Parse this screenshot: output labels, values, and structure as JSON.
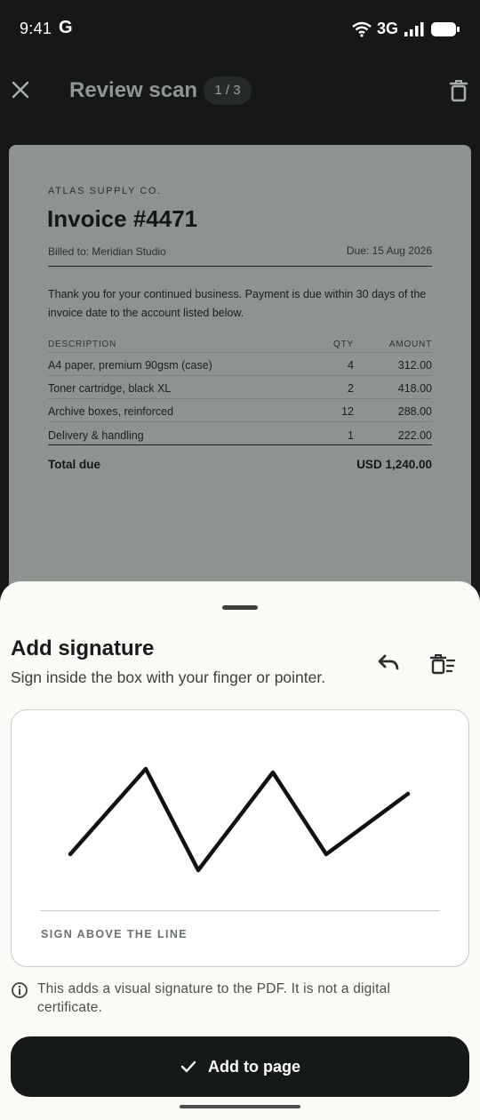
{
  "status": {
    "time": "9:41",
    "google": "G",
    "network": "3G"
  },
  "app_bar": {
    "title": "Review scan",
    "page_indicator": "1 / 3"
  },
  "document": {
    "company": "ATLAS SUPPLY CO.",
    "title": "Invoice #4471",
    "billed_to": "Billed to: Meridian Studio",
    "due": "Due: 15 Aug 2026",
    "note": "Thank you for your continued business. Payment is due within 30 days of the invoice date to the account listed below.",
    "columns": {
      "description": "DESCRIPTION",
      "qty": "QTY",
      "amount": "AMOUNT"
    },
    "rows": [
      {
        "description": "A4 paper, premium 90gsm (case)",
        "qty": "4",
        "amount": "312.00"
      },
      {
        "description": "Toner cartridge, black XL",
        "qty": "2",
        "amount": "418.00"
      },
      {
        "description": "Archive boxes, reinforced",
        "qty": "12",
        "amount": "288.00"
      },
      {
        "description": "Delivery & handling",
        "qty": "1",
        "amount": "222.00"
      }
    ],
    "total_label": "Total due",
    "total_value": "USD 1,240.00"
  },
  "sheet": {
    "title": "Add signature",
    "subtitle": "Sign inside the box with your finger or pointer.",
    "sign_caption": "SIGN ABOVE THE LINE",
    "info": "This adds a visual signature to the PDF. It is not a digital certificate.",
    "primary_button": "Add to page"
  },
  "icons": {
    "close": "close-icon",
    "delete": "trash-icon",
    "undo": "undo-icon",
    "clear": "clear-signature-icon",
    "info": "info-icon",
    "check": "check-icon"
  },
  "colors": {
    "accent_dark": "#151a17",
    "sheet_bg": "#fbfaf6",
    "doc_bg": "#8f9390"
  }
}
